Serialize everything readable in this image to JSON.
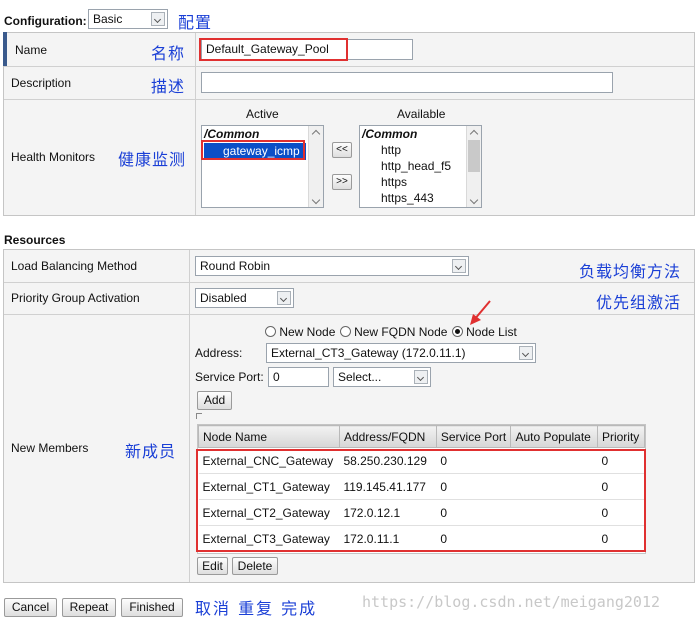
{
  "configuration": {
    "label": "Configuration:",
    "mode_value": "Basic",
    "mode_annotation": "配置"
  },
  "general": {
    "name_label": "Name",
    "name_value": "Default_Gateway_Pool",
    "name_annotation": "名称",
    "description_label": "Description",
    "description_value": "",
    "description_annotation": "描述",
    "health_label": "Health Monitors",
    "health_annotation": "健康监测",
    "active_header": "Active",
    "available_header": "Available",
    "active_items": [
      "/Common",
      "gateway_icmp"
    ],
    "available_items": [
      "/Common",
      "http",
      "http_head_f5",
      "https",
      "https_443"
    ],
    "move_left_label": "<<",
    "move_right_label": ">>"
  },
  "resources": {
    "title": "Resources",
    "lb_method_label": "Load Balancing Method",
    "lb_method_value": "Round Robin",
    "lb_method_annotation": "负载均衡方法",
    "priority_label": "Priority Group Activation",
    "priority_value": "Disabled",
    "priority_annotation": "优先组激活",
    "new_members_label": "New Members",
    "new_members_annotation": "新成员",
    "radio_options": [
      "New Node",
      "New FQDN Node",
      "Node List"
    ],
    "radio_selected": "Node List",
    "address_label": "Address:",
    "address_value": "External_CT3_Gateway (172.0.11.1)",
    "service_port_label": "Service Port:",
    "service_port_value": "0",
    "service_select_value": "Select...",
    "add_label": "Add",
    "table_headers": [
      "Node Name",
      "Address/FQDN",
      "Service Port",
      "Auto Populate",
      "Priority"
    ],
    "table_rows": [
      [
        "External_CNC_Gateway",
        "58.250.230.129",
        "0",
        "",
        "0"
      ],
      [
        "External_CT1_Gateway",
        "119.145.41.177",
        "0",
        "",
        "0"
      ],
      [
        "External_CT2_Gateway",
        "172.0.12.1",
        "0",
        "",
        "0"
      ],
      [
        "External_CT3_Gateway",
        "172.0.11.1",
        "0",
        "",
        "0"
      ]
    ],
    "edit_label": "Edit",
    "delete_label": "Delete"
  },
  "footer": {
    "cancel_label": "Cancel",
    "repeat_label": "Repeat",
    "finished_label": "Finished",
    "annotation": "取消 重复 完成",
    "watermark": "https://blog.csdn.net/meigang2012"
  },
  "colors": {
    "annotation": "#1a3fd6",
    "highlight_box": "#e03030",
    "selected_item": "#0a4fc7",
    "left_accent": "#3a5a8c"
  }
}
